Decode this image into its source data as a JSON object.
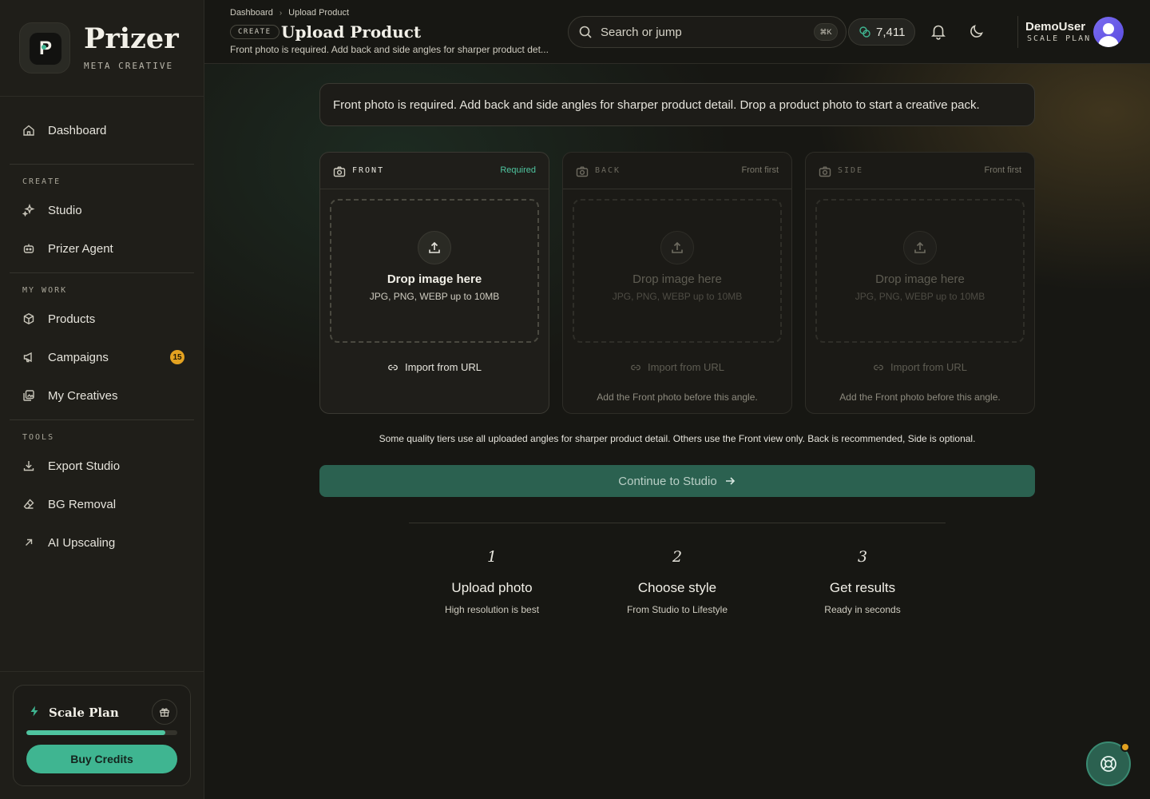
{
  "brand": {
    "name": "Prizer",
    "subtitle": "META CREATIVE",
    "logo_letter": "P"
  },
  "sidebar": {
    "sections": {
      "create": "CREATE",
      "my_work": "MY WORK",
      "tools": "TOOLS"
    },
    "items": [
      {
        "label": "Dashboard",
        "icon": "home-icon"
      },
      {
        "label": "Studio",
        "icon": "sparkles-icon"
      },
      {
        "label": "Prizer Agent",
        "icon": "bot-icon"
      },
      {
        "label": "Products",
        "icon": "box-icon"
      },
      {
        "label": "Campaigns",
        "icon": "megaphone-icon",
        "badge": "15"
      },
      {
        "label": "My Creatives",
        "icon": "images-icon"
      },
      {
        "label": "Export Studio",
        "icon": "download-icon"
      },
      {
        "label": "BG Removal",
        "icon": "eraser-icon"
      },
      {
        "label": "AI Upscaling",
        "icon": "arrow-up-right-icon"
      }
    ],
    "plan": {
      "title": "Scale Plan",
      "progress": 0.92,
      "buy_label": "Buy Credits"
    }
  },
  "header": {
    "breadcrumb": [
      "Dashboard",
      "Upload Product"
    ],
    "pill": "CREATE",
    "title": "Upload Product",
    "subtitle": "Front photo is required. Add back and side angles for sharper product det...",
    "search_placeholder": "Search or jump",
    "shortcut": "⌘K",
    "credits": "7,411",
    "user": {
      "name": "DemoUser",
      "plan": "SCALE PLAN"
    }
  },
  "main": {
    "info": "Front photo is required. Add back and side angles for sharper product detail. Drop a product photo to start a creative pack.",
    "cards": [
      {
        "angle": "FRONT",
        "tag": "Required",
        "drop_title": "Drop image here",
        "drop_sub": "JPG, PNG, WEBP up to 10MB",
        "url_label": "Import from URL",
        "note": ""
      },
      {
        "angle": "BACK",
        "tag": "Front first",
        "drop_title": "Drop image here",
        "drop_sub": "JPG, PNG, WEBP up to 10MB",
        "url_label": "Import from URL",
        "note": "Add the Front photo before this angle."
      },
      {
        "angle": "SIDE",
        "tag": "Front first",
        "drop_title": "Drop image here",
        "drop_sub": "JPG, PNG, WEBP up to 10MB",
        "url_label": "Import from URL",
        "note": "Add the Front photo before this angle."
      }
    ],
    "quality_note": "Some quality tiers use all uploaded angles for sharper product detail. Others use the Front view only. Back is recommended, Side is optional.",
    "continue_label": "Continue to Studio",
    "steps": [
      {
        "num": "1",
        "title": "Upload photo",
        "sub": "High resolution is best"
      },
      {
        "num": "2",
        "title": "Choose style",
        "sub": "From Studio to Lifestyle"
      },
      {
        "num": "3",
        "title": "Get results",
        "sub": "Ready in seconds"
      }
    ]
  },
  "colors": {
    "accent": "#3fb591",
    "badge": "#e3a221",
    "continue_bg": "#2b6150"
  }
}
